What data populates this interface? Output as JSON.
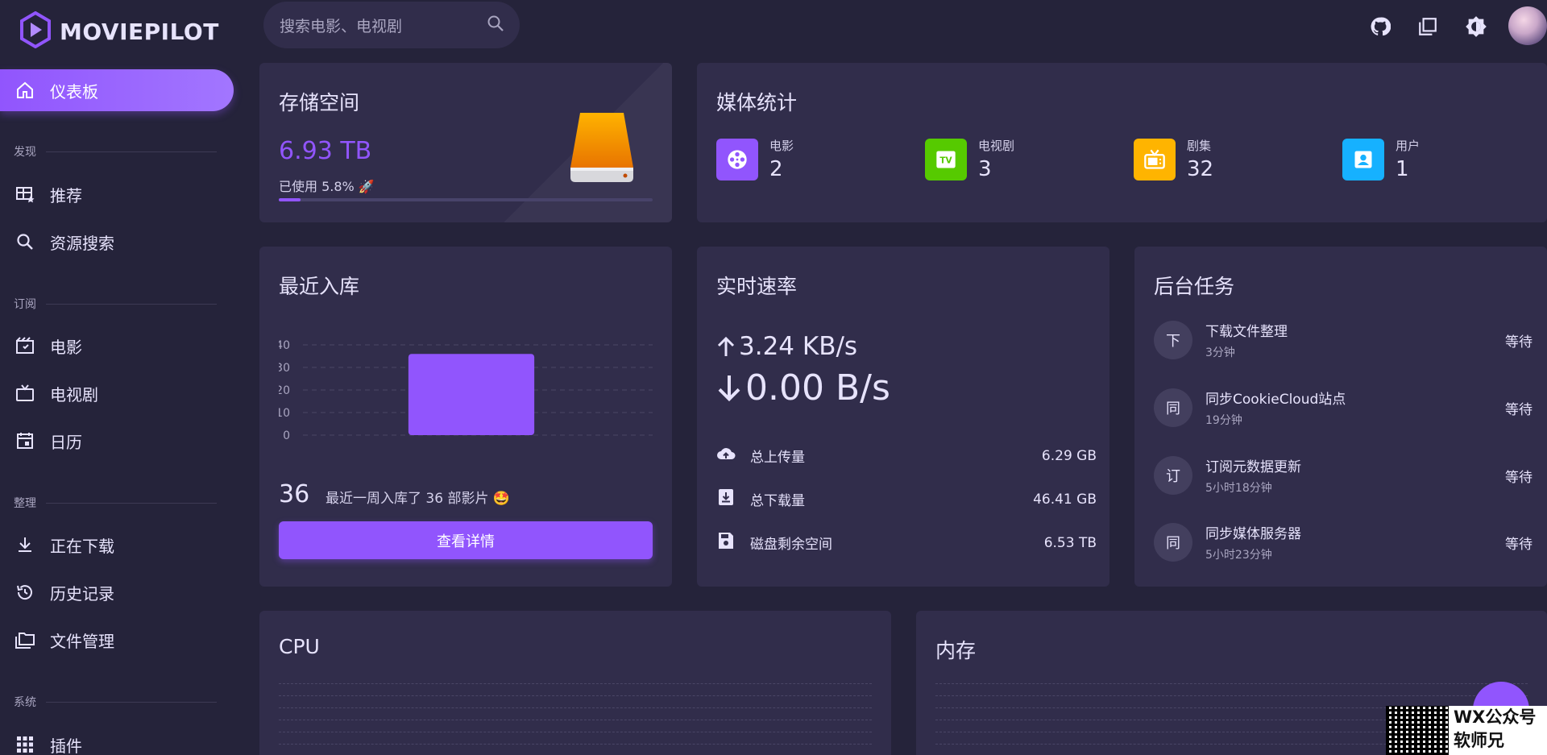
{
  "app": {
    "name": "MOVIEPILOT"
  },
  "search": {
    "placeholder": "搜索电影、电视剧"
  },
  "sidebar": {
    "active": {
      "label": "仪表板"
    },
    "sections": [
      {
        "title": "发现",
        "items": [
          "推荐",
          "资源搜索"
        ]
      },
      {
        "title": "订阅",
        "items": [
          "电影",
          "电视剧",
          "日历"
        ]
      },
      {
        "title": "整理",
        "items": [
          "正在下载",
          "历史记录",
          "文件管理"
        ]
      },
      {
        "title": "系统",
        "items": [
          "插件"
        ]
      }
    ]
  },
  "storage": {
    "title": "存储空间",
    "total": "6.93 TB",
    "used_text": "已使用 5.8% 🚀",
    "used_percent": 5.8
  },
  "media": {
    "title": "媒体统计",
    "stats": [
      {
        "label": "电影",
        "value": "2",
        "color": "#9155fd",
        "icon": "film-reel-icon"
      },
      {
        "label": "电视剧",
        "value": "3",
        "color": "#56ca00",
        "icon": "tv-icon"
      },
      {
        "label": "剧集",
        "value": "32",
        "color": "#ffb400",
        "icon": "television-icon"
      },
      {
        "label": "用户",
        "value": "1",
        "color": "#16b1ff",
        "icon": "user-icon"
      }
    ]
  },
  "recent": {
    "title": "最近入库",
    "count": "36",
    "text": "最近一周入库了 36 部影片 🤩",
    "button": "查看详情",
    "chart_data": {
      "type": "bar",
      "categories": [
        ""
      ],
      "values": [
        36
      ],
      "ylim": [
        0,
        40
      ],
      "yticks": [
        "0",
        "10",
        "20",
        "30",
        "40"
      ],
      "color": "#9155fd"
    }
  },
  "speed": {
    "title": "实时速率",
    "upload": "3.24 KB/s",
    "download": "0.00 B/s",
    "rows": [
      {
        "label": "总上传量",
        "value": "6.29 GB",
        "icon": "cloud-upload-icon"
      },
      {
        "label": "总下载量",
        "value": "46.41 GB",
        "icon": "download-box-icon"
      },
      {
        "label": "磁盘剩余空间",
        "value": "6.53 TB",
        "icon": "floppy-disk-icon"
      }
    ]
  },
  "tasks": {
    "title": "后台任务",
    "items": [
      {
        "avatar": "下",
        "name": "下载文件整理",
        "time": "3分钟",
        "status": "等待"
      },
      {
        "avatar": "同",
        "name": "同步CookieCloud站点",
        "time": "19分钟",
        "status": "等待"
      },
      {
        "avatar": "订",
        "name": "订阅元数据更新",
        "time": "5小时18分钟",
        "status": "等待"
      },
      {
        "avatar": "同",
        "name": "同步媒体服务器",
        "time": "5小时23分钟",
        "status": "等待"
      }
    ]
  },
  "cpu": {
    "title": "CPU"
  },
  "memory": {
    "title": "内存"
  },
  "watermark": {
    "line1": "WX公众号",
    "line2": "软师兄"
  }
}
